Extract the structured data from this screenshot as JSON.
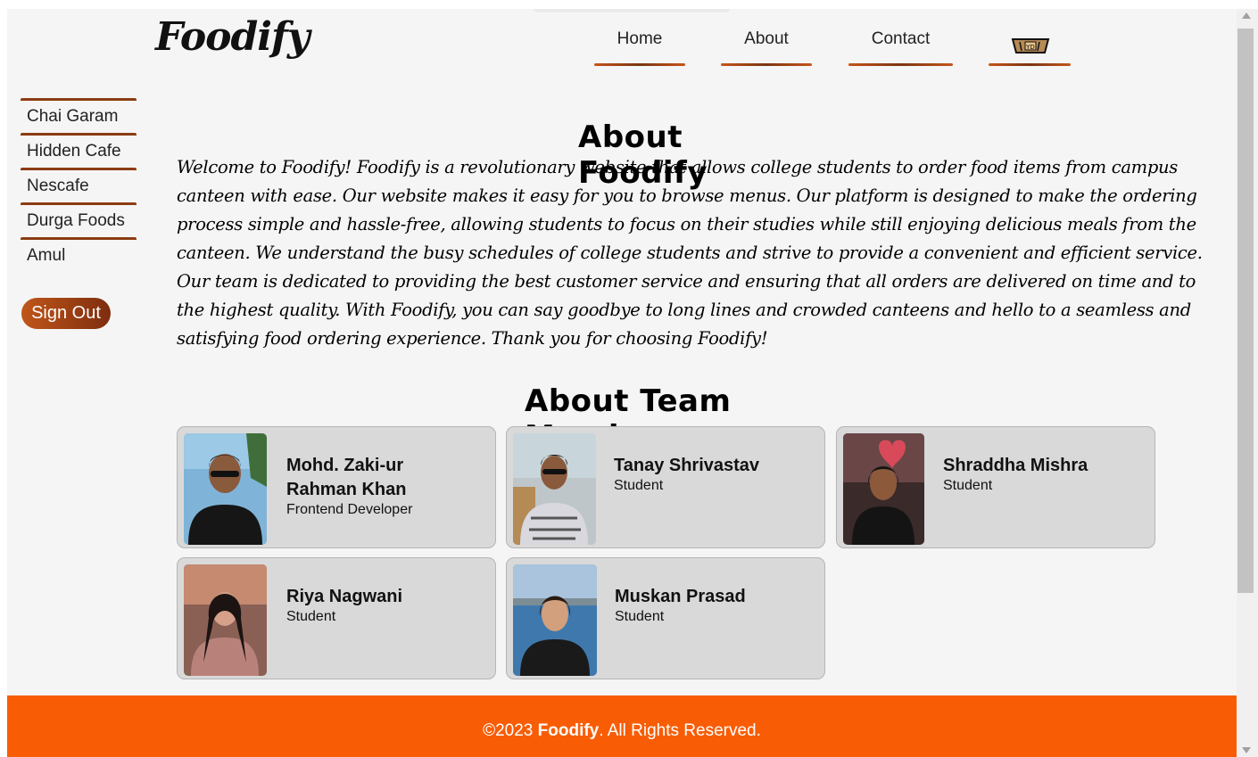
{
  "brand": {
    "logo": "Foodify"
  },
  "nav": {
    "home": "Home",
    "about": "About",
    "contact": "Contact",
    "cart_icon": "cart-icon"
  },
  "sidebar": {
    "items": [
      {
        "label": "Chai Garam"
      },
      {
        "label": "Hidden Cafe"
      },
      {
        "label": "Nescafe"
      },
      {
        "label": "Durga Foods"
      },
      {
        "label": "Amul"
      }
    ],
    "signout_label": "Sign Out"
  },
  "about": {
    "title": "About Foodify",
    "text": "Welcome to Foodify! Foodify is a revolutionary website that allows college students to order food items from campus canteen with ease. Our website makes it easy for you to browse menus. Our platform is designed to make the ordering process simple and hassle-free, allowing students to focus on their studies while still enjoying delicious meals from the canteen. We understand the busy schedules of college students and strive to provide a convenient and efficient service. Our team is dedicated to providing the best customer service and ensuring that all orders are delivered on time and to the highest quality. With Foodify, you can say goodbye to long lines and crowded canteens and hello to a seamless and satisfying food ordering experience. Thank you for choosing Foodify!"
  },
  "team": {
    "title": "About Team Member",
    "members": [
      {
        "name": "Mohd. Zaki-ur Rahman Khan",
        "role": "Frontend Developer"
      },
      {
        "name": "Tanay Shrivastav",
        "role": "Student"
      },
      {
        "name": "Shraddha Mishra",
        "role": "Student"
      },
      {
        "name": "Riya Nagwani",
        "role": "Student"
      },
      {
        "name": "Muskan Prasad",
        "role": "Student"
      }
    ]
  },
  "footer": {
    "prefix": "©2023 ",
    "brand": "Foodify",
    "suffix": ". All Rights Reserved."
  },
  "colors": {
    "accent": "#8b3c13",
    "footer": "#f85d06",
    "card": "#d9d9d9"
  }
}
